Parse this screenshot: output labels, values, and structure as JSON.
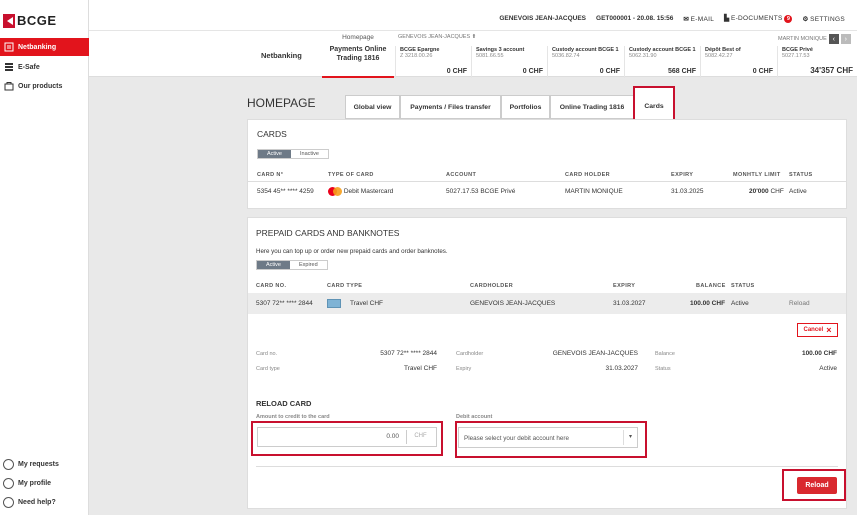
{
  "brand": {
    "logo_text": "BCGE",
    "accent": "#e2141c"
  },
  "sidebar": {
    "items": [
      {
        "label": "Netbanking",
        "icon": "netbanking-icon"
      },
      {
        "label": "E-Safe",
        "icon": "safe-icon"
      },
      {
        "label": "Our products",
        "icon": "bag-icon"
      }
    ],
    "bottom": [
      {
        "label": "My requests",
        "icon": "requests-icon"
      },
      {
        "label": "My profile",
        "icon": "profile-icon"
      },
      {
        "label": "Need help?",
        "icon": "help-icon"
      }
    ]
  },
  "topbar": {
    "user": "GENEVOIS JEAN-JACQUES",
    "contract": "GET000001",
    "datetime": "- 20.08. 15:56",
    "email": "E-MAIL",
    "edocs": "E-DOCUMENTS",
    "edocs_count": "9",
    "settings": "SETTINGS"
  },
  "accountbar": {
    "netbanking": "Netbanking",
    "homepage": "Homepage",
    "payments": "Payments Online Trading 1816",
    "owner": "GENEVOIS JEAN-JACQUES",
    "owner2": "MARTIN MONIQUE",
    "accounts": [
      {
        "name": "BCGE Epargne",
        "number": "Z 3218.00.26",
        "amount": "0 CHF"
      },
      {
        "name": "Savings 3 account",
        "number": "5081.66.55",
        "amount": "0 CHF"
      },
      {
        "name": "Custody account BCGE 1",
        "number": "5036.82.74",
        "amount": "0 CHF"
      },
      {
        "name": "Custody account BCGE 1",
        "number": "5062.31.90",
        "amount": "568 CHF"
      },
      {
        "name": "Dépôt Best of",
        "number": "5082.42.27",
        "amount": "0 CHF"
      },
      {
        "name": "BCGE Privé",
        "number": "5027.17.53",
        "amount": "34'357 CHF"
      }
    ]
  },
  "page": {
    "title": "HOMEPAGE",
    "tabs": [
      "Global view",
      "Payments / Files transfer",
      "Portfolios",
      "Online Trading 1816",
      "Cards"
    ]
  },
  "cards": {
    "title": "CARDS",
    "toggle": [
      "Active",
      "Inactive"
    ],
    "headers": [
      "CARD N°",
      "TYPE OF CARD",
      "ACCOUNT",
      "CARD HOLDER",
      "EXPIRY",
      "MONHTLY LIMIT",
      "STATUS"
    ],
    "row": {
      "number": "5354 45** **** 4259",
      "type": "Debit Mastercard",
      "account": "5027.17.53 BCGE Privé",
      "holder": "MARTIN MONIQUE",
      "expiry": "31.03.2025",
      "limit": "20'000",
      "limit_cur": "CHF",
      "status": "Active"
    }
  },
  "prepaid": {
    "title": "PREPAID CARDS AND BANKNOTES",
    "description": "Here you can top up or order new prepaid cards and order banknotes.",
    "toggle": [
      "Active",
      "Expired"
    ],
    "headers": [
      "CARD NO.",
      "CARD TYPE",
      "CARDHOLDER",
      "EXPIRY",
      "BALANCE",
      "STATUS"
    ],
    "row": {
      "number": "5307 72** **** 2844",
      "type": "Travel CHF",
      "holder": "GENEVOIS JEAN-JACQUES",
      "expiry": "31.03.2027",
      "balance": "100.00 CHF",
      "status": "Active",
      "action": "Reload"
    },
    "cancel": "Cancel",
    "details": {
      "card_no_label": "Card no.",
      "card_no": "5307 72** **** 2844",
      "card_type_label": "Card type",
      "card_type": "Travel CHF",
      "holder_label": "Cardholder",
      "holder": "GENEVOIS JEAN-JACQUES",
      "expiry_label": "Expiry",
      "expiry": "31.03.2027",
      "balance_label": "Balance",
      "balance": "100.00 CHF",
      "status_label": "Status",
      "status": "Active"
    },
    "reload": {
      "title": "RELOAD CARD",
      "amount_label": "Amount to credit to the card",
      "amount_value": "0.00",
      "currency": "CHF",
      "debit_label": "Debit account",
      "debit_placeholder": "Please select your debit account here",
      "button": "Reload"
    }
  }
}
